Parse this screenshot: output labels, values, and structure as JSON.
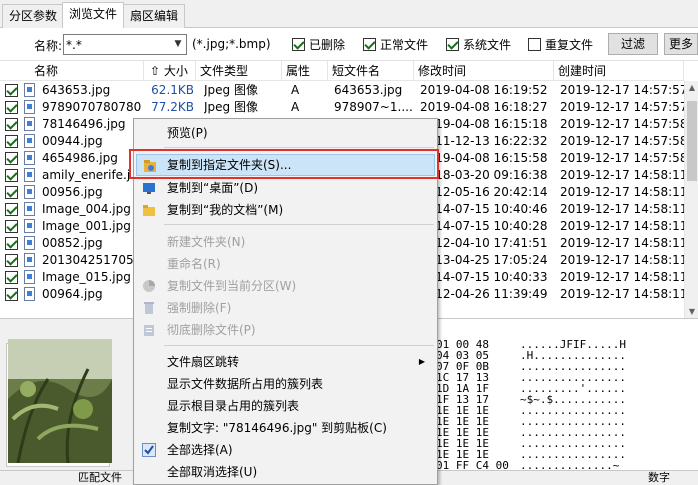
{
  "tabs": [
    "分区参数",
    "浏览文件",
    "扇区编辑"
  ],
  "filter": {
    "label": "名称:",
    "value": "*.*",
    "ext_hint": "(*.jpg;*.bmp)",
    "checkboxes": [
      {
        "label": "已删除",
        "checked": true
      },
      {
        "label": "正常文件",
        "checked": true
      },
      {
        "label": "系统文件",
        "checked": true
      },
      {
        "label": "重复文件",
        "checked": false
      }
    ],
    "filter_button": "过滤",
    "more_button": "更多"
  },
  "columns": [
    "名称",
    "大小",
    "文件类型",
    "属性",
    "短文件名",
    "修改时间",
    "创建时间"
  ],
  "rows": [
    {
      "name": "643653.jpg",
      "size": "62.1KB",
      "type": "Jpeg 图像",
      "attr": "A",
      "short": "643653.jpg",
      "mtime": "2019-04-08 16:19:52",
      "ctime": "2019-12-17 14:57:57"
    },
    {
      "name": "9789070780780.j...",
      "size": "77.2KB",
      "type": "Jpeg 图像",
      "attr": "A",
      "short": "978907~1....",
      "mtime": "2019-04-08 16:18:27",
      "ctime": "2019-12-17 14:57:57"
    },
    {
      "name": "78146496.jpg",
      "size": "",
      "type": "",
      "attr": "",
      "short": "",
      "mtime": "2019-04-08 16:15:18",
      "ctime": "2019-12-17 14:57:58"
    },
    {
      "name": "00944.jpg",
      "size": "",
      "type": "",
      "attr": "",
      "short": "",
      "mtime": "2011-12-13 16:22:32",
      "ctime": "2019-12-17 14:57:58"
    },
    {
      "name": "4654986.jpg",
      "size": "",
      "type": "",
      "attr": "",
      "short": "",
      "mtime": "2019-04-08 16:15:58",
      "ctime": "2019-12-17 14:57:58"
    },
    {
      "name": "amily_enerife.j...",
      "size": "",
      "type": "",
      "attr": "",
      "short": "",
      "mtime": "2018-03-20 09:16:38",
      "ctime": "2019-12-17 14:58:11"
    },
    {
      "name": "00956.jpg",
      "size": "",
      "type": "",
      "attr": "",
      "short": "",
      "mtime": "2012-05-16 20:42:14",
      "ctime": "2019-12-17 14:58:11"
    },
    {
      "name": "Image_004.jpg",
      "size": "",
      "type": "",
      "attr": "",
      "short": "",
      "mtime": "2014-07-15 10:40:46",
      "ctime": "2019-12-17 14:58:11"
    },
    {
      "name": "Image_001.jpg",
      "size": "",
      "type": "",
      "attr": "",
      "short": "",
      "mtime": "2014-07-15 10:40:28",
      "ctime": "2019-12-17 14:58:11"
    },
    {
      "name": "00852.jpg",
      "size": "",
      "type": "",
      "attr": "",
      "short": "",
      "mtime": "2012-04-10 17:41:51",
      "ctime": "2019-12-17 14:58:11"
    },
    {
      "name": "201304251705...",
      "size": "",
      "type": "",
      "attr": "",
      "short": "",
      "mtime": "2013-04-25 17:05:24",
      "ctime": "2019-12-17 14:58:11"
    },
    {
      "name": "Image_015.jpg",
      "size": "",
      "type": "",
      "attr": "",
      "short": "",
      "mtime": "2014-07-15 10:40:33",
      "ctime": "2019-12-17 14:58:11"
    },
    {
      "name": "00964.jpg",
      "size": "",
      "type": "",
      "attr": "",
      "short": "",
      "mtime": "2012-04-26 11:39:49",
      "ctime": "2019-12-17 14:58:11"
    }
  ],
  "hex": [
    {
      "hex": "01 00 48",
      "ascii": "......JFIF.....H"
    },
    {
      "hex": "04 03 05",
      "ascii": ".H.............."
    },
    {
      "hex": "07 0F 0B",
      "ascii": "................"
    },
    {
      "hex": "1C 17 13",
      "ascii": "................"
    },
    {
      "hex": "1D 1A 1F",
      "ascii": ".........'......"
    },
    {
      "hex": "1F 13 17",
      "ascii": "~$~.$..........."
    },
    {
      "hex": "1E 1E 1E",
      "ascii": "................"
    },
    {
      "hex": "1E 1E 1E",
      "ascii": "................"
    },
    {
      "hex": "1E 1E 1E",
      "ascii": "................"
    },
    {
      "hex": "1E 1E 1E",
      "ascii": "................"
    },
    {
      "hex": "1E 1E 1E",
      "ascii": "................"
    },
    {
      "hex": "01 FF C4 00",
      "ascii": "..............~"
    }
  ],
  "status": {
    "left": "匹配文件",
    "right": "数字"
  },
  "menu": {
    "preview": "预览(P)",
    "copy_to_folder": "复制到指定文件夹(S)...",
    "copy_to_desktop": "复制到“桌面”(D)",
    "copy_to_documents": "复制到“我的文档”(M)",
    "new_folder": "新建文件夹(N)",
    "rename": "重命名(R)",
    "copy_to_partition": "复制文件到当前分区(W)",
    "force_delete": "强制删除(F)",
    "wipe_delete": "彻底删除文件(P)",
    "jump_sector": "文件扇区跳转",
    "show_clusters": "显示文件数据所占用的簇列表",
    "show_root_clusters": "显示根目录占用的簇列表",
    "copy_text": "复制文字: \"78146496.jpg\" 到剪贴板(C)",
    "select_all": "全部选择(A)",
    "deselect_all": "全部取消选择(U)"
  }
}
